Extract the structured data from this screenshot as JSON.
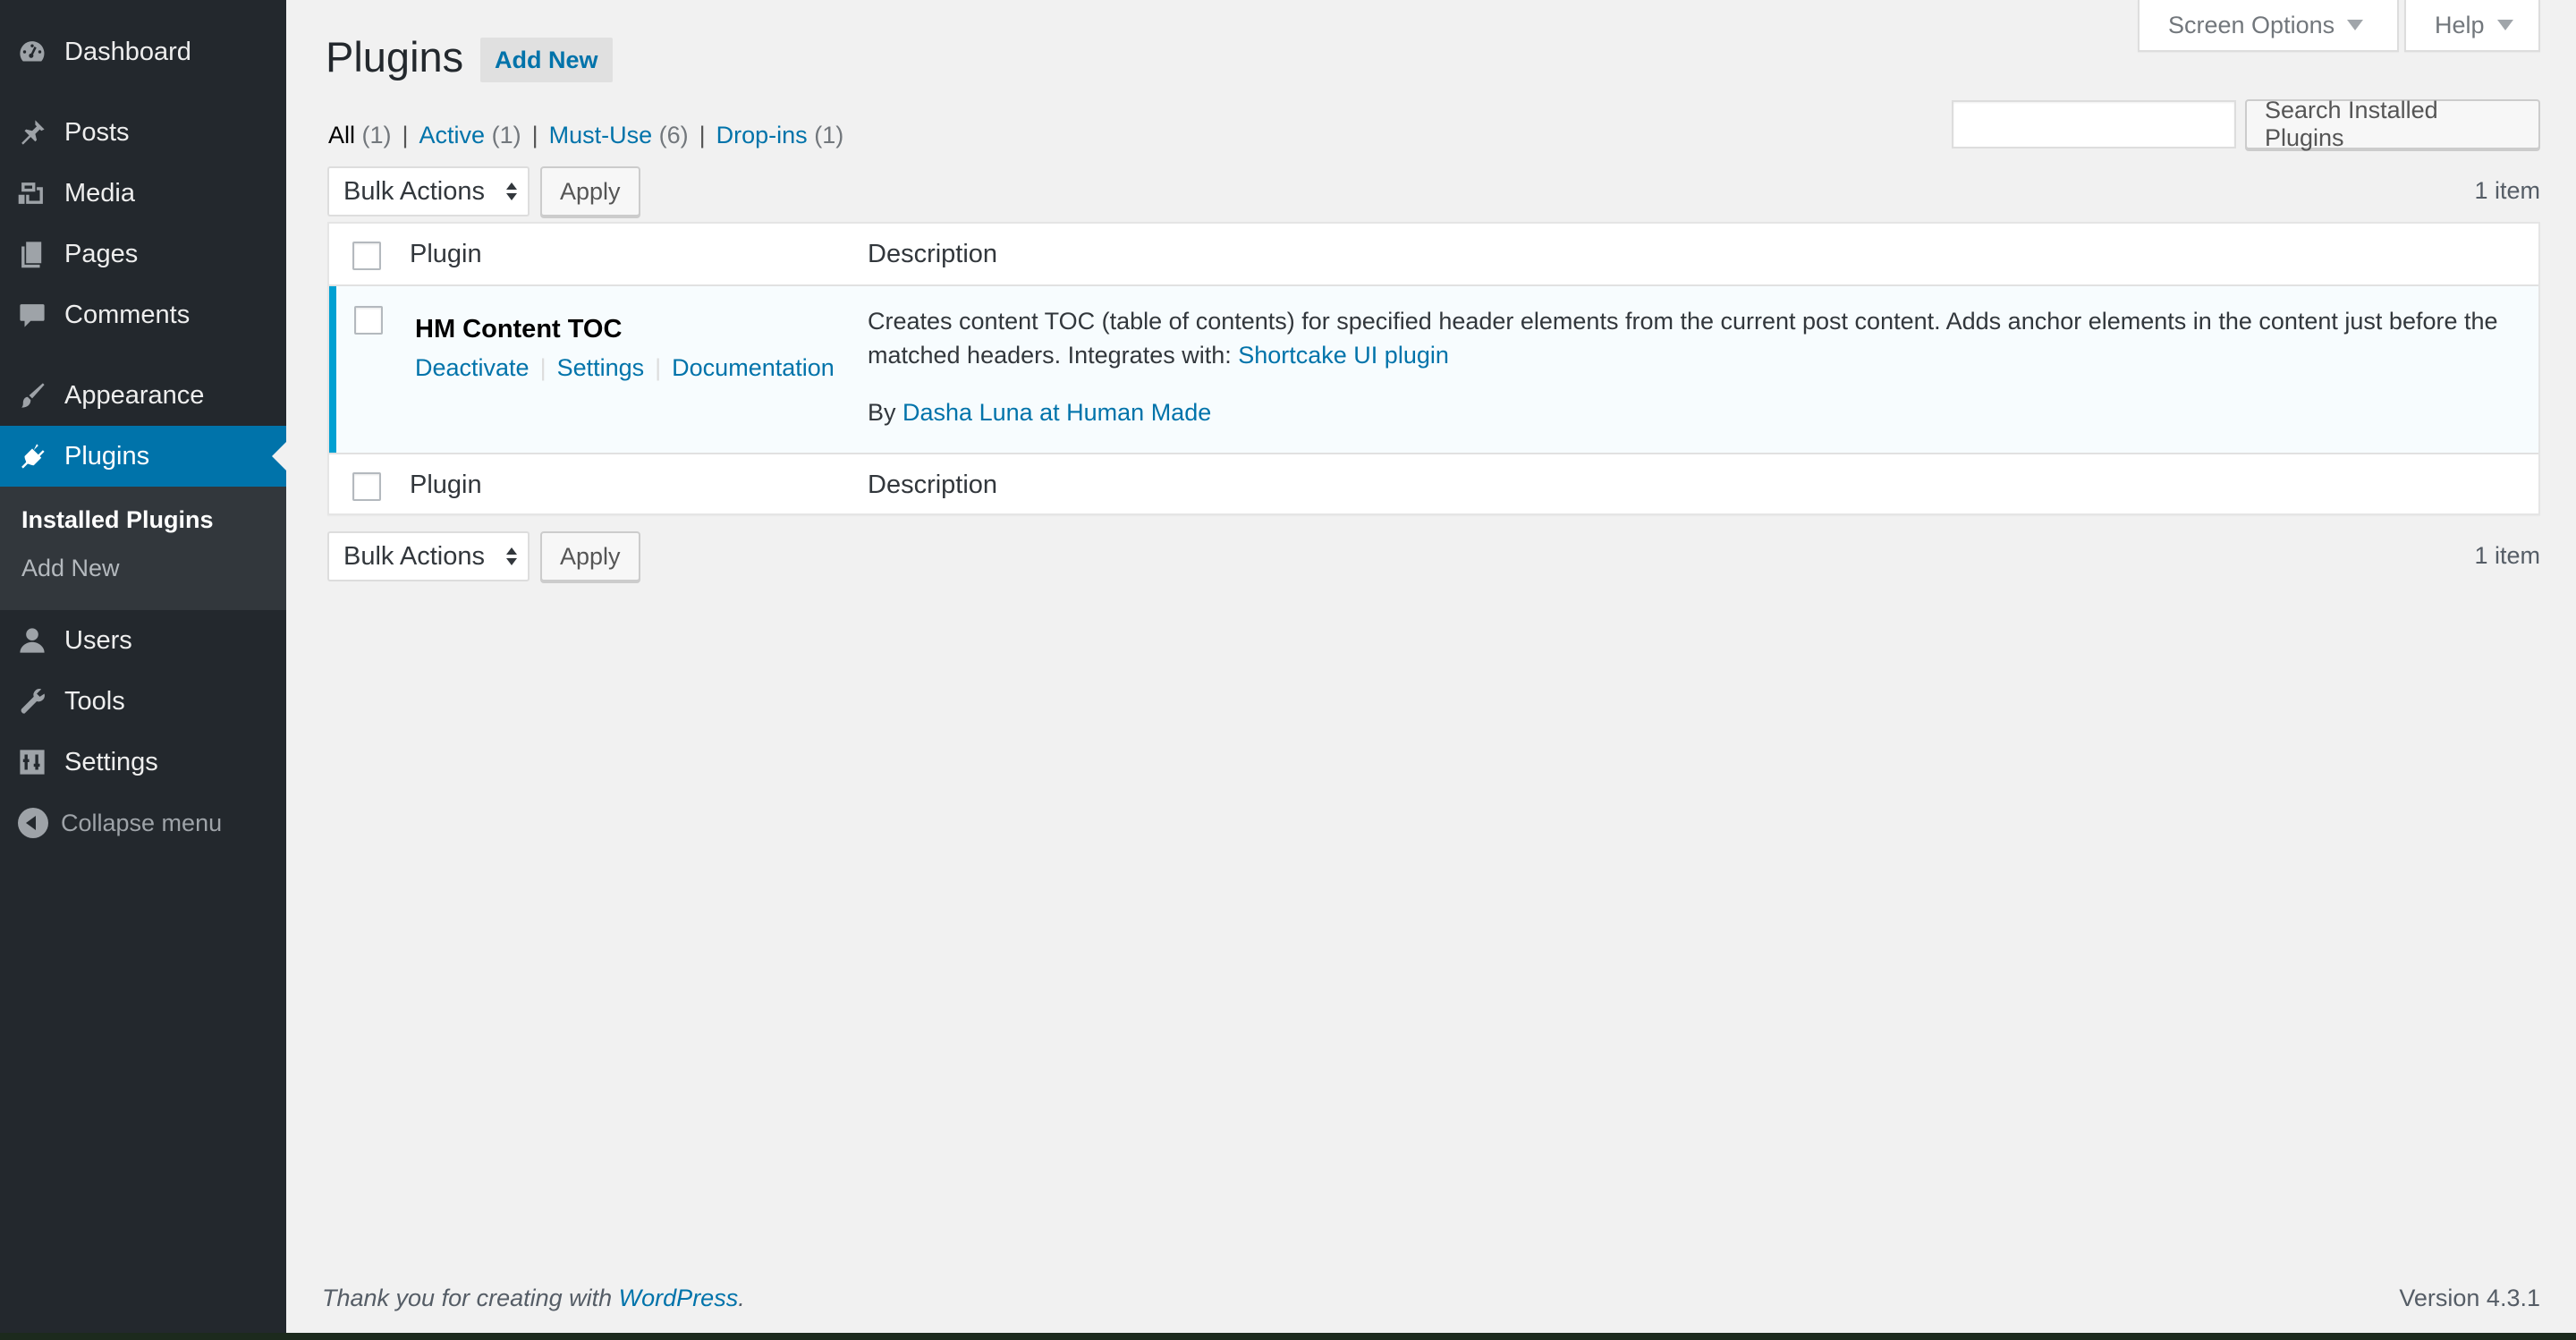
{
  "sidebar": {
    "items": [
      {
        "label": "Dashboard",
        "icon": "dashboard-icon"
      },
      {
        "label": "Posts",
        "icon": "pin-icon"
      },
      {
        "label": "Media",
        "icon": "media-icon"
      },
      {
        "label": "Pages",
        "icon": "pages-icon"
      },
      {
        "label": "Comments",
        "icon": "comment-icon"
      },
      {
        "label": "Appearance",
        "icon": "brush-icon"
      },
      {
        "label": "Plugins",
        "icon": "plug-icon"
      },
      {
        "label": "Users",
        "icon": "user-icon"
      },
      {
        "label": "Tools",
        "icon": "wrench-icon"
      },
      {
        "label": "Settings",
        "icon": "sliders-icon"
      }
    ],
    "submenu": {
      "installed": "Installed Plugins",
      "add_new": "Add New"
    },
    "collapse": "Collapse menu"
  },
  "screen_meta": {
    "screen_options": "Screen Options",
    "help": "Help"
  },
  "header": {
    "title": "Plugins",
    "add_new": "Add New"
  },
  "filters": {
    "all": {
      "label": "All",
      "count": "(1)"
    },
    "active": {
      "label": "Active",
      "count": "(1)"
    },
    "must_use": {
      "label": "Must-Use",
      "count": "(6)"
    },
    "dropins": {
      "label": "Drop-ins",
      "count": "(1)"
    },
    "separator": "|"
  },
  "search": {
    "value": "",
    "button": "Search Installed Plugins"
  },
  "tablenav": {
    "bulk_actions": "Bulk Actions",
    "apply": "Apply",
    "count": "1 item"
  },
  "table": {
    "columns": [
      "Plugin",
      "Description"
    ],
    "rows": [
      {
        "name": "HM Content TOC",
        "actions": [
          "Deactivate",
          "Settings",
          "Documentation"
        ],
        "description": "Creates content TOC (table of contents) for specified header elements from the current post content. Adds anchor elements in the content just before the matched headers. Integrates with: ",
        "description_link": "Shortcake UI plugin",
        "by_prefix": "By ",
        "author": "Dasha Luna at Human Made"
      }
    ]
  },
  "footer": {
    "thanks_prefix": "Thank you for creating with ",
    "thanks_link": "WordPress",
    "thanks_suffix": ".",
    "version": "Version 4.3.1"
  },
  "colors": {
    "sidebar_bg": "#23282d",
    "accent": "#0073aa",
    "active_row_border": "#00a0d2",
    "page_bg": "#f1f1f1"
  }
}
